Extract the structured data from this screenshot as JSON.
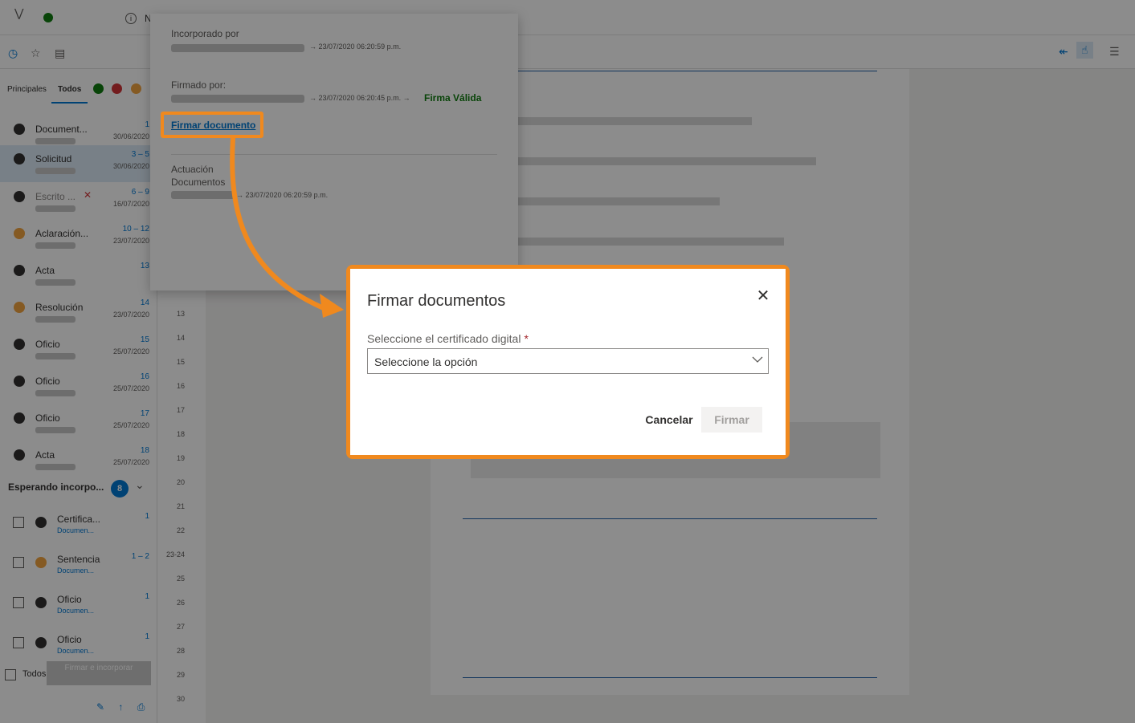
{
  "topbar": {
    "letter": "N"
  },
  "left_pane": {
    "tabs": [
      {
        "label": "Principales"
      },
      {
        "label": "Todos"
      }
    ],
    "documents": [
      {
        "name": "Document...",
        "pages": "1",
        "date": "30/06/2020",
        "icon": "document-icon"
      },
      {
        "name": "Solicitud",
        "pages": "3 – 5",
        "date": "30/06/2020",
        "icon": "signed-icon"
      },
      {
        "name": "Escrito ...",
        "pages": "6 – 9",
        "date": "16/07/2020",
        "icon": "signed-icon"
      },
      {
        "name": "Aclaración...",
        "pages": "10 – 12",
        "date": "23/07/2020",
        "icon": "pending-icon"
      },
      {
        "name": "Acta",
        "pages": "13",
        "date": "",
        "icon": "stamp-icon"
      },
      {
        "name": "Resolución",
        "pages": "14",
        "date": "23/07/2020",
        "icon": "pending-icon"
      },
      {
        "name": "Oficio",
        "pages": "15",
        "date": "25/07/2020",
        "icon": "stamp-icon"
      },
      {
        "name": "Oficio",
        "pages": "16",
        "date": "25/07/2020",
        "icon": "stamp-icon"
      },
      {
        "name": "Oficio",
        "pages": "17",
        "date": "25/07/2020",
        "icon": "stamp-icon"
      },
      {
        "name": "Acta",
        "pages": "18",
        "date": "25/07/2020",
        "icon": "stamp-icon"
      }
    ],
    "waiting": {
      "title": "Esperando incorpo...",
      "count": "8"
    },
    "waiting_items": [
      {
        "name": "Certifica...",
        "sub": "Documen...",
        "pages": "1"
      },
      {
        "name": "Sentencia",
        "sub": "Documen...",
        "pages": "1 – 2"
      },
      {
        "name": "Oficio",
        "sub": "Documen...",
        "pages": "1"
      },
      {
        "name": "Oficio",
        "sub": "Documen...",
        "pages": "1"
      }
    ],
    "footer": {
      "todos": "Todos",
      "sign_button": "Firmar e incorporar"
    }
  },
  "page_numbers": [
    "13",
    "14",
    "15",
    "16",
    "17",
    "18",
    "19",
    "20",
    "21",
    "22",
    "23-24",
    "25",
    "26",
    "27",
    "28",
    "29",
    "30"
  ],
  "popover": {
    "incorporated_label": "Incorporado por",
    "incorporated_meta": "→ 23/07/2020 06:20:59 p.m.",
    "signed_label": "Firmado por:",
    "signed_meta": "→ 23/07/2020 06:20:45 p.m. →",
    "signature_status": "Firma Válida",
    "sign_link": "Firmar documento",
    "actuacion_label": "Actuación",
    "documentos_label": "Documentos",
    "actuacion_meta": "→ 23/07/2020 06:20:59 p.m."
  },
  "dialog": {
    "title": "Firmar documentos",
    "field_label": "Seleccione el certificado digital",
    "required_mark": "*",
    "select_value": "Seleccione la opción",
    "cancel_label": "Cancelar",
    "confirm_label": "Firmar"
  },
  "colors": {
    "accent": "#0078d4",
    "highlight": "#f0891e",
    "valid": "#107c10",
    "required": "#a4262c"
  }
}
